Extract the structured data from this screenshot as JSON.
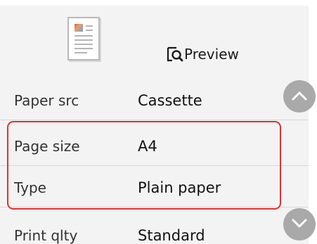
{
  "preview": {
    "label": "Preview",
    "icon": "preview-magnifier-icon"
  },
  "settings": [
    {
      "key": "paper_src",
      "label": "Paper src",
      "value": "Cassette"
    },
    {
      "key": "page_size",
      "label": "Page size",
      "value": "A4"
    },
    {
      "key": "type",
      "label": "Type",
      "value": "Plain paper"
    },
    {
      "key": "print_qlty",
      "label": "Print qlty",
      "value": "Standard"
    }
  ],
  "scroll": {
    "up_icon": "chevron-up-icon",
    "down_icon": "chevron-down-icon"
  },
  "colors": {
    "highlight": "#e3302f",
    "scroll_button": "#a9a9a9",
    "background": "#f3f3f3"
  }
}
